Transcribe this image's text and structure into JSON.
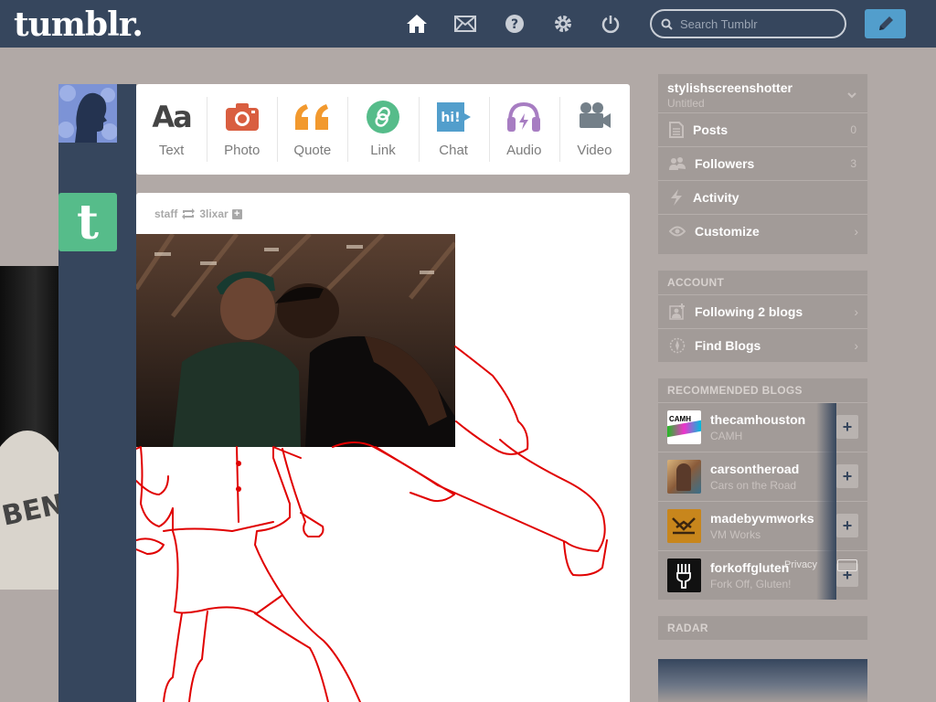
{
  "header": {
    "logo": "tumblr.",
    "search_placeholder": "Search Tumblr",
    "nav_icons": [
      "home-icon",
      "mail-icon",
      "help-icon",
      "gear-icon",
      "power-icon"
    ],
    "compose_icon": "pencil-icon"
  },
  "post_types": [
    {
      "label": "Text",
      "icon": "Aa",
      "color": "#444444"
    },
    {
      "label": "Photo",
      "icon": "camera-icon",
      "color": "#d95e40"
    },
    {
      "label": "Quote",
      "icon": "quote-icon",
      "color": "#f2992e"
    },
    {
      "label": "Link",
      "icon": "link-icon",
      "color": "#56bc8a"
    },
    {
      "label": "Chat",
      "icon": "hi!",
      "color": "#529ecc"
    },
    {
      "label": "Audio",
      "icon": "headphones-icon",
      "color": "#a77dc2"
    },
    {
      "label": "Video",
      "icon": "video-camera-icon",
      "color": "#748089"
    }
  ],
  "post": {
    "author": "staff",
    "reblogged_from": "3lixar",
    "avatar_letter": "t"
  },
  "sidebar": {
    "blog_name": "stylishscreenshotter",
    "blog_title": "Untitled",
    "items": [
      {
        "label": "Posts",
        "count": "0",
        "icon": "document-icon"
      },
      {
        "label": "Followers",
        "count": "3",
        "icon": "people-icon"
      },
      {
        "label": "Activity",
        "count": "",
        "icon": "lightning-icon"
      },
      {
        "label": "Customize",
        "count": "",
        "icon": "eye-icon"
      }
    ],
    "account_heading": "ACCOUNT",
    "account_items": [
      {
        "label": "Following 2 blogs",
        "icon": "add-person-icon"
      },
      {
        "label": "Find Blogs",
        "icon": "compass-icon"
      }
    ],
    "recommended_heading": "RECOMMENDED BLOGS",
    "recommended": [
      {
        "name": "thecamhouston",
        "sub": "CAMH",
        "thumb_text": "CAMH"
      },
      {
        "name": "carsontheroad",
        "sub": "Cars on the Road",
        "thumb_text": ""
      },
      {
        "name": "madebyvmworks",
        "sub": "VM Works",
        "thumb_text": ""
      },
      {
        "name": "forkoffgluten",
        "sub": "Fork Off, Gluten!",
        "thumb_text": ""
      }
    ],
    "footer_overlay": "Privacy",
    "radar_heading": "RADAR"
  },
  "colors": {
    "header_bg": "#36465d",
    "page_bg": "#b1a9a6",
    "sidebar_bg": "#a29b98",
    "compose_bg": "#529ecc",
    "drawing_stroke": "#e00000"
  }
}
